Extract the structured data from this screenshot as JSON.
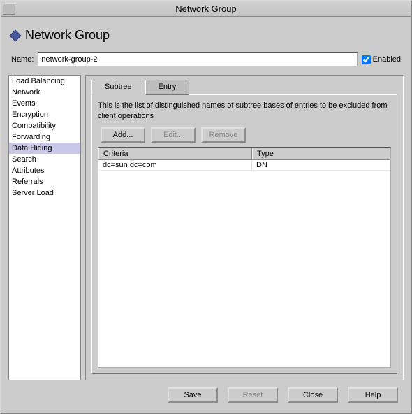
{
  "window": {
    "title": "Network Group"
  },
  "page": {
    "title": "Network Group"
  },
  "name_row": {
    "label": "Name:",
    "value": "network-group-2",
    "enabled_label": "Enabled",
    "enabled_checked": true
  },
  "nav": {
    "items": [
      "Load Balancing",
      "Network",
      "Events",
      "Encryption",
      "Compatibility",
      "Forwarding",
      "Data Hiding",
      "Search",
      "Attributes",
      "Referrals",
      "Server Load"
    ],
    "selected_index": 6
  },
  "tabs": {
    "items": [
      "Subtree",
      "Entry"
    ],
    "selected_index": 0
  },
  "subtree": {
    "description": "This is the list of distinguished names of subtree bases of entries to be excluded from client operations",
    "buttons": {
      "add": "Add...",
      "edit": "Edit...",
      "remove": "Remove"
    },
    "columns": [
      "Criteria",
      "Type"
    ],
    "rows": [
      {
        "criteria": "dc=sun dc=com",
        "type": "DN"
      }
    ]
  },
  "footer": {
    "save": "Save",
    "reset": "Reset",
    "close": "Close",
    "help": "Help"
  }
}
